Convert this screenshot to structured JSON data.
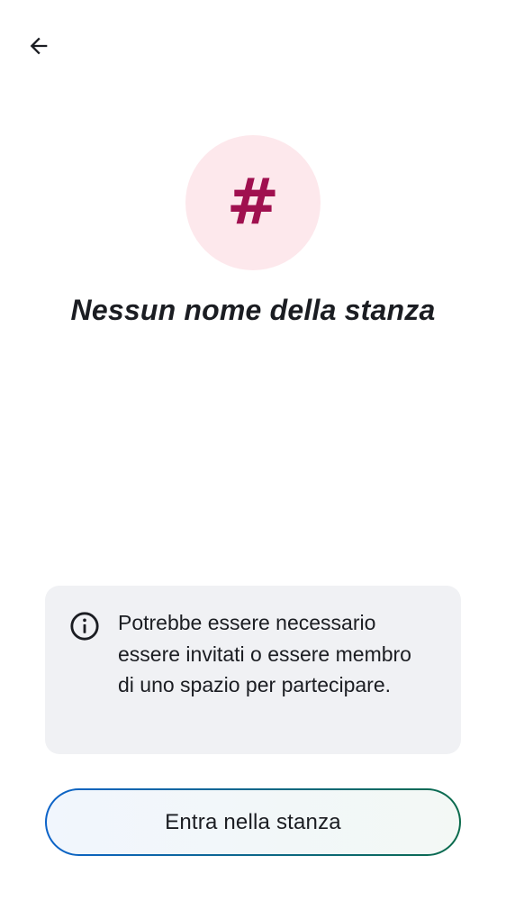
{
  "header": {
    "back_icon": "arrow-left-icon"
  },
  "room": {
    "avatar_symbol": "#",
    "avatar_bg_color": "#fde8ec",
    "avatar_fg_color": "#a0104f",
    "title": "Nessun nome della stanza"
  },
  "notice": {
    "icon": "info-icon",
    "text": "Potrebbe essere necessario essere invitati o essere membro di uno spazio per partecipare."
  },
  "actions": {
    "join_label": "Entra nella stanza",
    "join_border_gradient": [
      "#0c63c9",
      "#0b6b4c"
    ]
  }
}
